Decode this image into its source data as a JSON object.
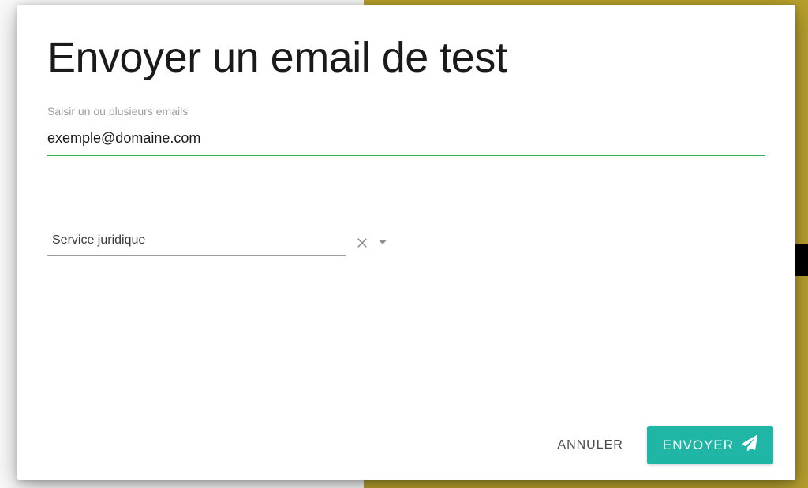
{
  "modal": {
    "title": "Envoyer un email de test",
    "email_field": {
      "label": "Saisir un ou plusieurs emails",
      "value": "exemple@domaine.com"
    },
    "select_field": {
      "value": "Service juridique"
    },
    "actions": {
      "cancel": "ANNULER",
      "send": "ENVOYER"
    }
  },
  "colors": {
    "accent_green": "#2fb457",
    "send_button": "#1fb6a5"
  }
}
